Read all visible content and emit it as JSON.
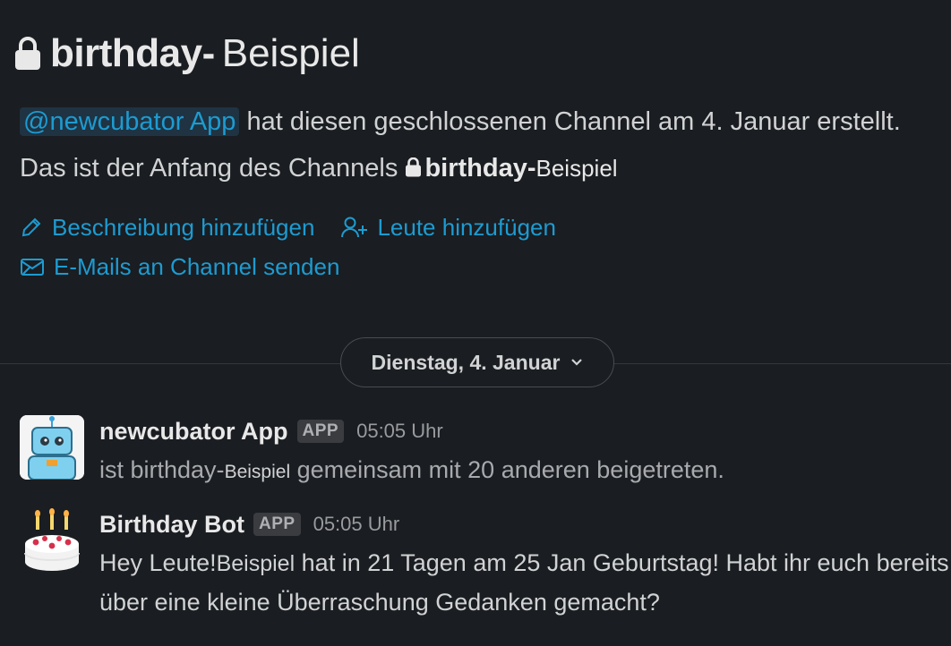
{
  "channel": {
    "name_bold": "birthday-",
    "name_light": "Beispiel"
  },
  "intro": {
    "mention": "@newcubator App",
    "text_1": " hat diesen geschlossenen Channel am 4. Januar erstellt. Das ist der Anfang des Channels ",
    "channel_bold": "birthday-",
    "channel_light": "Beispiel"
  },
  "actions": {
    "add_description": "Beschreibung hinzufügen",
    "add_people": "Leute hinzufügen",
    "email_channel": "E-Mails an Channel senden"
  },
  "date_divider": {
    "label": "Dienstag, 4. Januar"
  },
  "messages": [
    {
      "sender": "newcubator App",
      "badge": "APP",
      "time": "05:05 Uhr",
      "text_1": "ist birthday-",
      "text_name": "Beispiel",
      "text_2": " gemeinsam mit 20 anderen beigetreten.",
      "avatar_icon": "robot-avatar-icon"
    },
    {
      "sender": "Birthday Bot",
      "badge": "APP",
      "time": "05:05 Uhr",
      "text_1": "Hey Leute!",
      "text_name": "Beispiel",
      "text_2": " hat in 21 Tagen am 25 Jan Geburtstag! Habt ihr euch bereits über eine kleine Überraschung Gedanken gemacht?",
      "avatar_icon": "birthday-cake-icon"
    }
  ],
  "colors": {
    "background": "#1a1d21",
    "link": "#1d9bd1",
    "text": "#d1d2d3"
  }
}
